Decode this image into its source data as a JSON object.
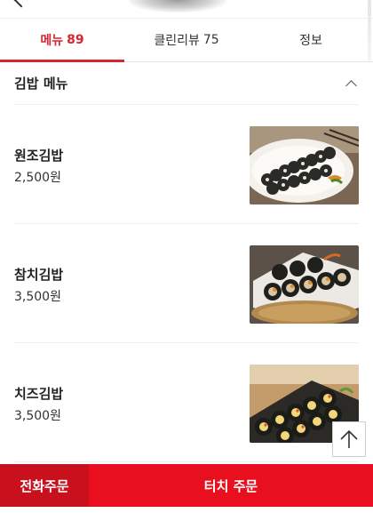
{
  "tabs": [
    {
      "label": "메뉴",
      "count": "89",
      "active": true
    },
    {
      "label": "클린리뷰",
      "count": "75",
      "active": false
    },
    {
      "label": "정보",
      "count": "",
      "active": false
    }
  ],
  "section": {
    "title": "김밥 메뉴"
  },
  "menu": [
    {
      "name": "원조김밥",
      "price": "2,500원",
      "photo": "kimbap-plate-photo"
    },
    {
      "name": "참치김밥",
      "price": "3,500원",
      "photo": "tuna-kimbap-photo"
    },
    {
      "name": "치즈김밥",
      "price": "3,500원",
      "photo": "cheese-kimbap-photo"
    }
  ],
  "bottom_bar": {
    "phone_order": "전화주문",
    "touch_order": "터치 주문"
  },
  "colors": {
    "accent": "#d7262f",
    "bottom_bar": "#e8101f",
    "phone_button": "#c8111c"
  },
  "icons": {
    "back": "chevron-left-icon",
    "collapse": "chevron-up-icon",
    "scroll_top": "arrow-up-icon"
  }
}
